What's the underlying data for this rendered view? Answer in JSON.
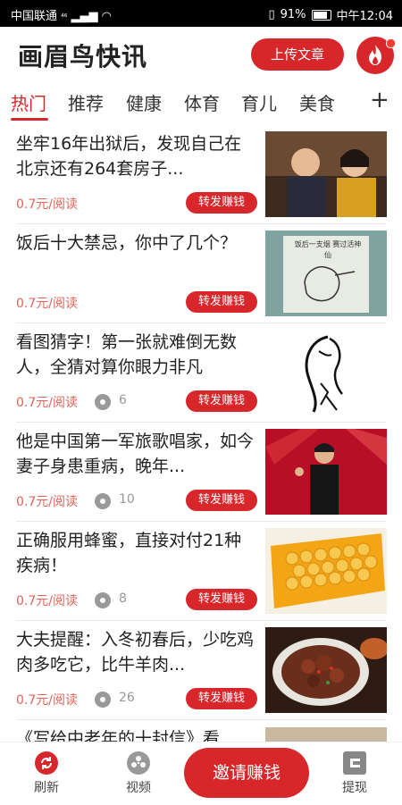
{
  "statusbar": {
    "carrier": "中国联通",
    "network": "⁴⁶",
    "battery": "91%",
    "time": "中午12:04"
  },
  "header": {
    "title": "画眉鸟快讯",
    "upload_label": "上传文章"
  },
  "tabs": [
    "热门",
    "推荐",
    "健康",
    "体育",
    "育儿",
    "美食"
  ],
  "tab_more": "+",
  "articles": [
    {
      "title": "坐牢16年出狱后，发现自己在北京还有264套房子...",
      "price": "0.7元/阅读",
      "views": "",
      "share": "转发赚钱",
      "thumb": "people-photo"
    },
    {
      "title": "饭后十大禁忌，你中了几个？",
      "price": "0.7元/阅读",
      "views": "",
      "share": "转发赚钱",
      "thumb": "illustration",
      "thumb_text": "饭后一支烟 赛过活神仙"
    },
    {
      "title": "看图猜字！第一张就难倒无数人，全猜对算你眼力非凡",
      "price": "0.7元/阅读",
      "views": "6",
      "share": "转发赚钱",
      "thumb": "ink-sketch"
    },
    {
      "title": "他是中国第一军旅歌唱家，如今妻子身患重病，晚年...",
      "price": "0.7元/阅读",
      "views": "10",
      "share": "转发赚钱",
      "thumb": "stage-photo"
    },
    {
      "title": "正确服用蜂蜜，直接对付21种疾病！",
      "price": "0.7元/阅读",
      "views": "8",
      "share": "转发赚钱",
      "thumb": "honeycomb"
    },
    {
      "title": "大夫提醒：入冬初春后，少吃鸡肉多吃它，比牛羊肉...",
      "price": "0.7元/阅读",
      "views": "26",
      "share": "转发赚钱",
      "thumb": "food-dish"
    }
  ],
  "partial_article_title": "《写给中老年的十封信》看",
  "bottom_nav": {
    "refresh": "刷新",
    "video": "视频",
    "invite": "邀请赚钱",
    "withdraw": "提现"
  },
  "colors": {
    "accent": "#d8272b",
    "price": "#e0645a"
  }
}
